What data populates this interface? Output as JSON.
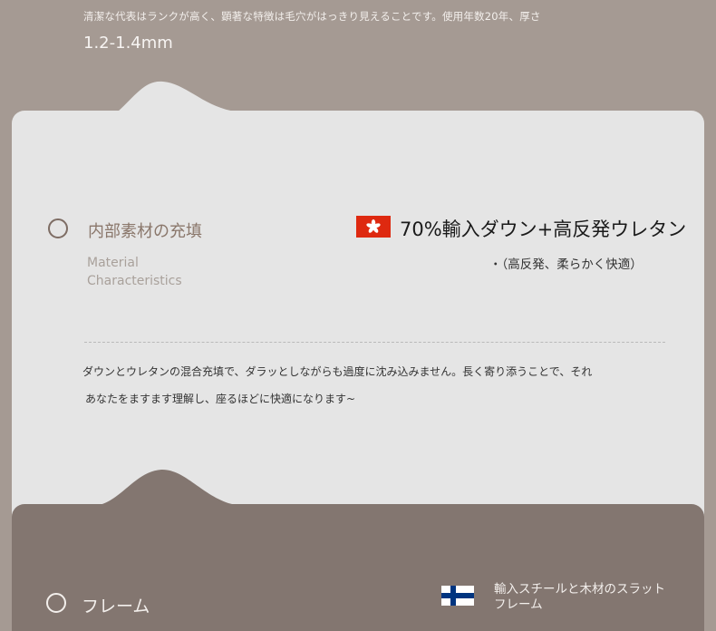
{
  "top": {
    "description": "清潔な代表はランクが高く、顕著な特徴は毛穴がはっきり見えることです。使用年数20年、厚さ",
    "description_cont": "1.2-1.4mm"
  },
  "filling": {
    "title": "内部素材の充填",
    "title_en_line1": "Material",
    "title_en_line2": "Characteristics",
    "main": "70%輸入ダウン+高反発ウレタン",
    "sub": "・（高反発、柔らかく快適）",
    "desc_line1": "ダウンとウレタンの混合充填で、ダラッとしながらも過度に沈み込みません。長く寄り添うことで、それ",
    "desc_line2": "あなたをますます理解し、座るほどに快適になります~"
  },
  "frame": {
    "title": "フレーム",
    "desc": "輸入スチールと木材のスラットフレーム"
  },
  "colors": {
    "top_bg": "#a59a93",
    "light_bg": "#e5e5e5",
    "dark_bg": "#837670",
    "accent": "#8a776b",
    "hk_red": "#de2910",
    "fi_blue": "#003580"
  }
}
